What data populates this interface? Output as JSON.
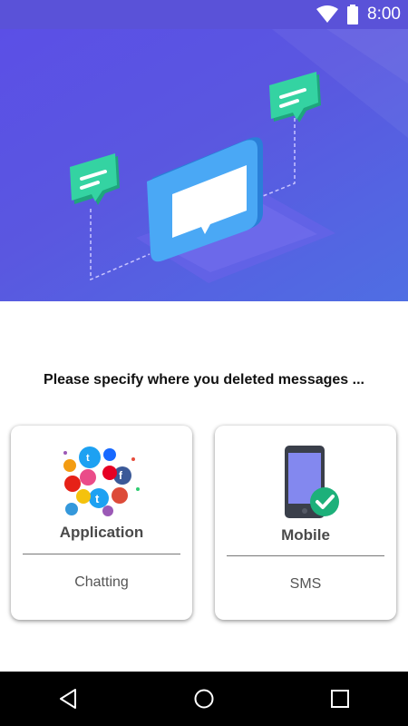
{
  "status_bar": {
    "time": "8:00",
    "icons": [
      "wifi-icon",
      "battery-icon"
    ]
  },
  "prompt": "Please specify where you deleted messages ...",
  "options": [
    {
      "title": "Application",
      "subtitle": "Chatting",
      "icon": "social-apps-icon"
    },
    {
      "title": "Mobile",
      "subtitle": "SMS",
      "icon": "mobile-check-icon"
    }
  ],
  "nav_bar": {
    "buttons": [
      "back-icon",
      "home-icon",
      "recents-icon"
    ]
  },
  "colors": {
    "hero_gradient_start": "#5b4fe6",
    "hero_gradient_end": "#4f6ee3",
    "accent_green": "#2ec79a",
    "check_green": "#1db07a"
  }
}
